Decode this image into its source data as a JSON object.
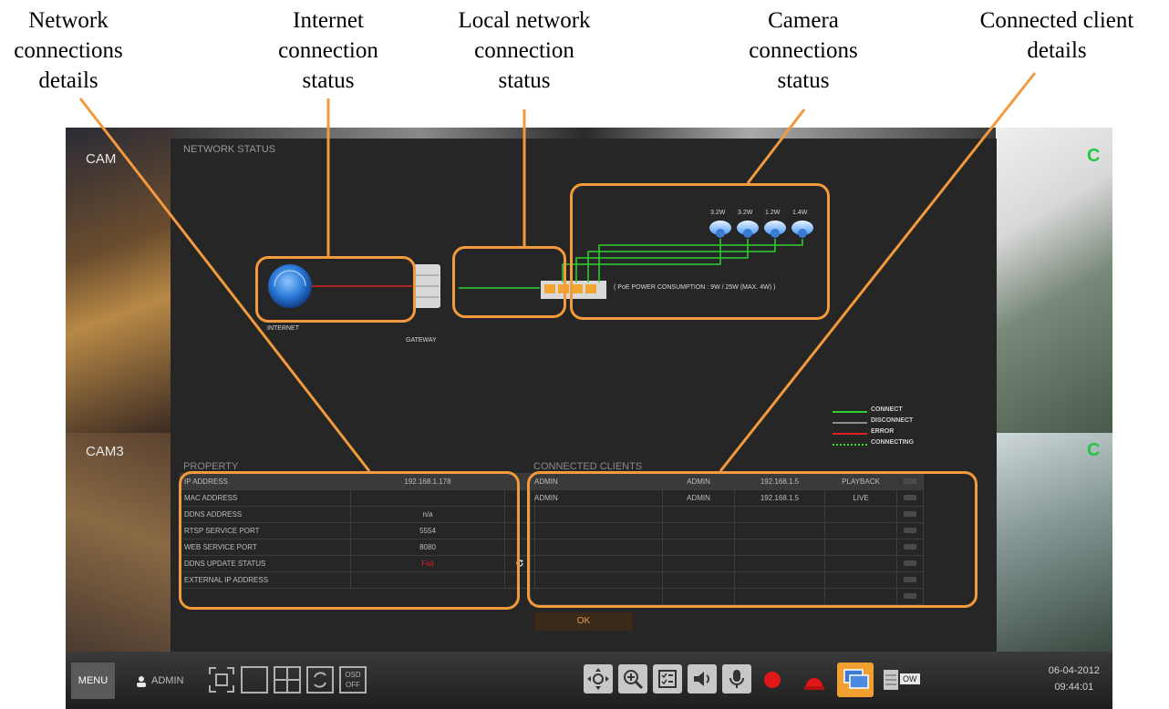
{
  "callouts": {
    "network_details": "Network\nconnections\ndetails",
    "internet_status": "Internet\nconnection\nstatus",
    "local_status": "Local network\nconnection\nstatus",
    "camera_status": "Camera\nconnections\nstatus",
    "client_details": "Connected client\ndetails"
  },
  "panel": {
    "title": "NETWORK STATUS",
    "internet_label": "INTERNET",
    "gateway_label": "GATEWAY",
    "poe_text": "( PoE POWER CONSUMPTION : 9W / 25W (MAX. 4W) )",
    "camera_watts": [
      "3.2W",
      "3.2W",
      "1.2W",
      "1.4W"
    ],
    "legend": [
      {
        "label": "CONNECT",
        "color": "#2fd12f",
        "style": "solid"
      },
      {
        "label": "DISCONNECT",
        "color": "#8a8a8a",
        "style": "solid"
      },
      {
        "label": "ERROR",
        "color": "#e02020",
        "style": "solid"
      },
      {
        "label": "CONNECTING",
        "color": "#2fd12f",
        "style": "dotted"
      }
    ],
    "property_title": "PROPERTY",
    "properties": [
      {
        "name": "IP ADDRESS",
        "value": "192.168.1.178"
      },
      {
        "name": "MAC ADDRESS",
        "value": ""
      },
      {
        "name": "DDNS ADDRESS",
        "value": "n/a"
      },
      {
        "name": "RTSP SERVICE PORT",
        "value": "5554"
      },
      {
        "name": "WEB SERVICE PORT",
        "value": "8080"
      },
      {
        "name": "DDNS UPDATE STATUS",
        "value": "Fail"
      },
      {
        "name": "EXTERNAL IP ADDRESS",
        "value": ""
      }
    ],
    "clients_title": "CONNECTED CLIENTS",
    "clients": [
      {
        "user": "ADMIN",
        "group": "ADMIN",
        "ip": "192.168.1.5",
        "mode": "PLAYBACK"
      },
      {
        "user": "ADMIN",
        "group": "ADMIN",
        "ip": "192.168.1.5",
        "mode": "LIVE"
      }
    ],
    "ok_label": "OK"
  },
  "feeds": {
    "cam_label": "CAM",
    "cam_label_2": "CAM3",
    "badge": "C"
  },
  "taskbar": {
    "menu_label": "MENU",
    "user": "ADMIN",
    "osd_label": "OSD\nOFF",
    "date": "06-04-2012",
    "time": "09:44:01",
    "ow_label": "OW"
  },
  "colors": {
    "accent": "#f39a3c",
    "connect": "#2fd12f",
    "error": "#e02020"
  }
}
